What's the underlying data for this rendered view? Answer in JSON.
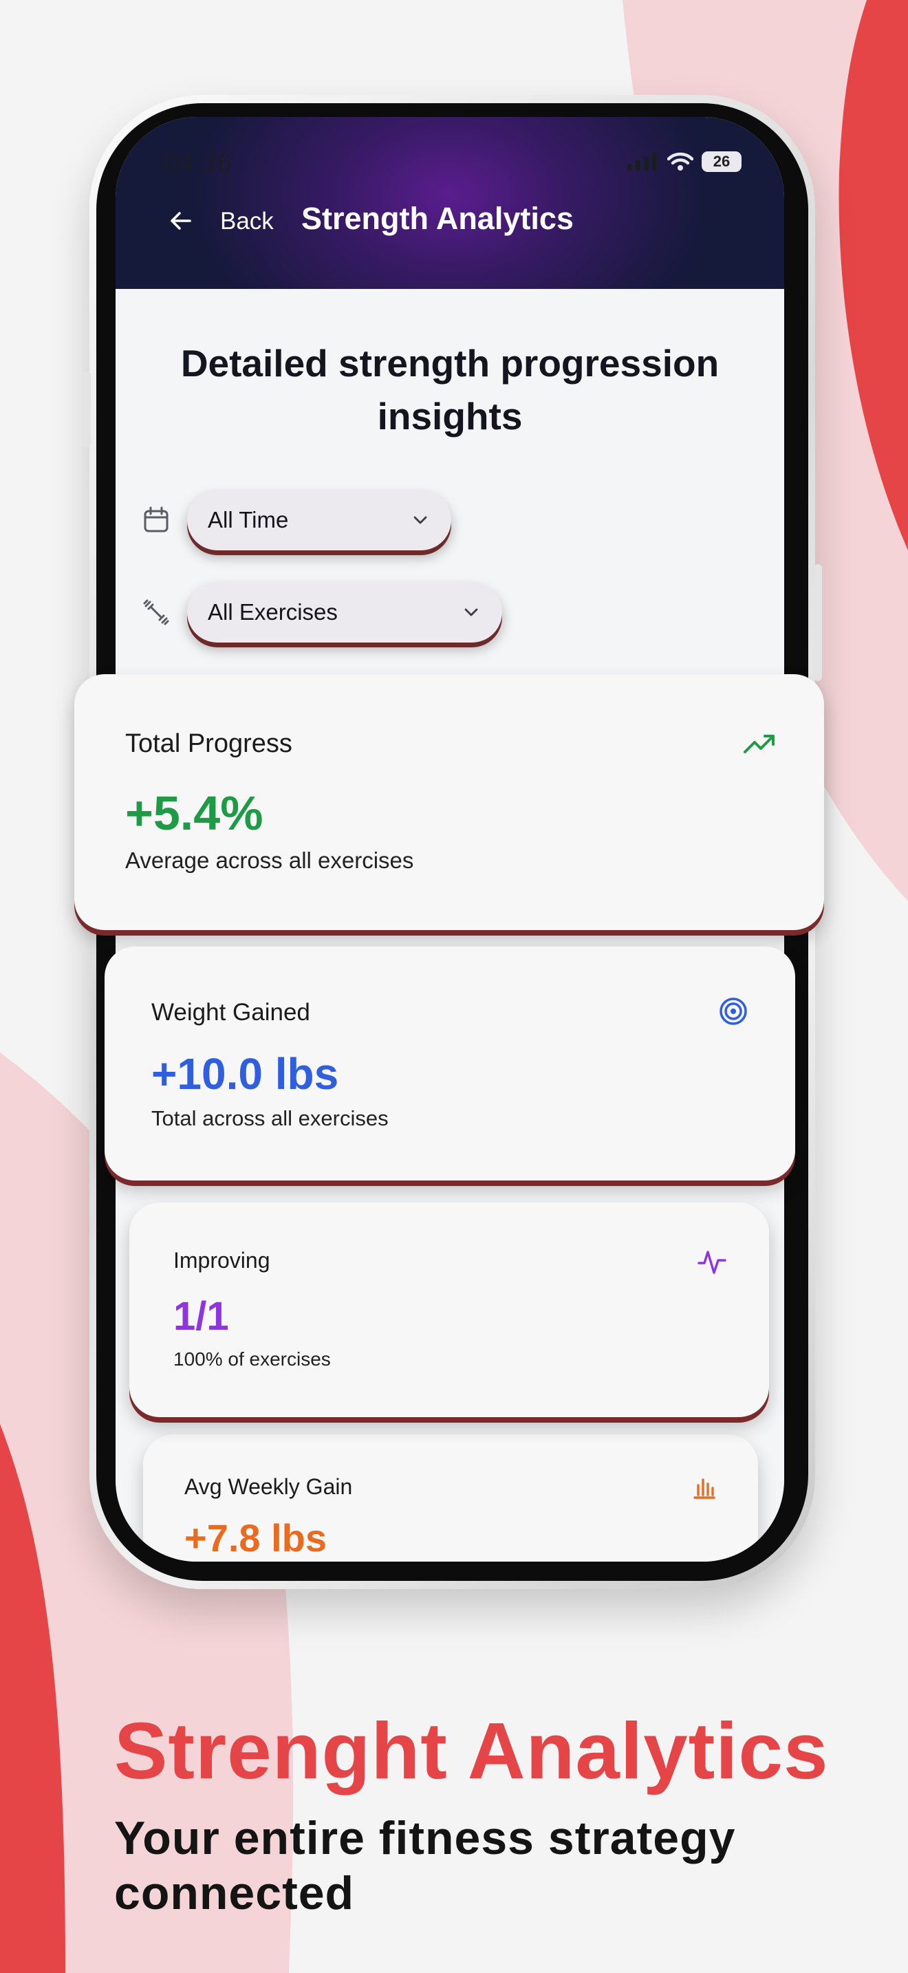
{
  "status_bar": {
    "time": "04:36",
    "battery": "26"
  },
  "header": {
    "back_label": "Back",
    "title": "Strength Analytics"
  },
  "page": {
    "heading": "Detailed strength progression insights"
  },
  "filters": {
    "time_range": {
      "value": "All Time",
      "icon": "calendar-icon"
    },
    "exercise": {
      "value": "All Exercises",
      "icon": "dumbbell-icon"
    }
  },
  "stats": [
    {
      "title": "Total Progress",
      "value": "+5.4%",
      "subtitle": "Average across all exercises",
      "icon": "trending-up-icon",
      "color": "#1e9c45"
    },
    {
      "title": "Weight Gained",
      "value": "+10.0 lbs",
      "subtitle": "Total across all exercises",
      "icon": "target-icon",
      "color": "#2f5fe0"
    },
    {
      "title": "Improving",
      "value": "1/1",
      "subtitle": "100% of exercises",
      "icon": "activity-icon",
      "color": "#8e35e0"
    },
    {
      "title": "Avg Weekly Gain",
      "value": "+7.8 lbs",
      "icon": "bar-chart-icon",
      "color": "#ea6a1e"
    }
  ],
  "marketing": {
    "headline": "Strenght Analytics",
    "tagline": "Your entire fitness strategy connected"
  },
  "colors": {
    "accent_red": "#e54546",
    "background": "#f4f4f4"
  }
}
